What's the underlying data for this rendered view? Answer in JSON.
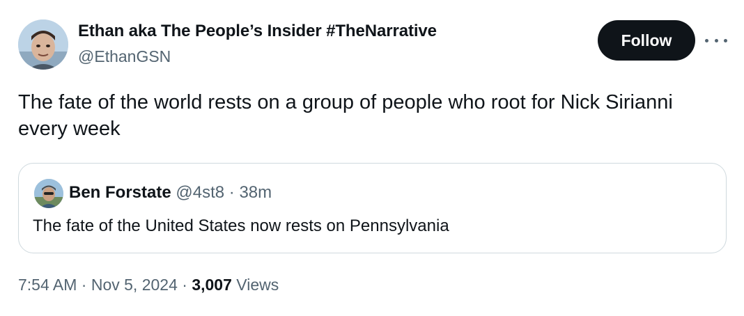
{
  "author": {
    "display_name": "Ethan aka The People’s Insider #TheNarrative",
    "handle": "@EthanGSN"
  },
  "actions": {
    "follow_label": "Follow",
    "more_icon": "more-horizontal-icon"
  },
  "tweet": {
    "text": "The fate of the world rests on a group of people who root for Nick Sirianni every week"
  },
  "quote": {
    "display_name": "Ben Forstate",
    "handle": "@4st8",
    "separator": " · ",
    "time": "38m",
    "text": "The fate of the United States now rests on Pennsylvania"
  },
  "meta": {
    "time": "7:54 AM",
    "sep1": " · ",
    "date": "Nov 5, 2024",
    "sep2": " · ",
    "views_count": "3,007",
    "views_label": " Views"
  },
  "colors": {
    "primary_text": "#0f1419",
    "secondary_text": "#536471",
    "border": "#cfd9de",
    "follow_bg": "#0f1419"
  }
}
